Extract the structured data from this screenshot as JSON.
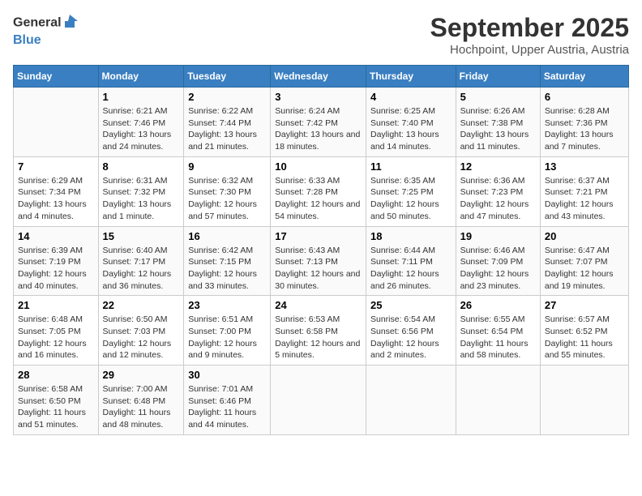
{
  "logo": {
    "text_general": "General",
    "text_blue": "Blue"
  },
  "title": "September 2025",
  "location": "Hochpoint, Upper Austria, Austria",
  "weekdays": [
    "Sunday",
    "Monday",
    "Tuesday",
    "Wednesday",
    "Thursday",
    "Friday",
    "Saturday"
  ],
  "weeks": [
    [
      {
        "day": "",
        "sunrise": "",
        "sunset": "",
        "daylight": ""
      },
      {
        "day": "1",
        "sunrise": "Sunrise: 6:21 AM",
        "sunset": "Sunset: 7:46 PM",
        "daylight": "Daylight: 13 hours and 24 minutes."
      },
      {
        "day": "2",
        "sunrise": "Sunrise: 6:22 AM",
        "sunset": "Sunset: 7:44 PM",
        "daylight": "Daylight: 13 hours and 21 minutes."
      },
      {
        "day": "3",
        "sunrise": "Sunrise: 6:24 AM",
        "sunset": "Sunset: 7:42 PM",
        "daylight": "Daylight: 13 hours and 18 minutes."
      },
      {
        "day": "4",
        "sunrise": "Sunrise: 6:25 AM",
        "sunset": "Sunset: 7:40 PM",
        "daylight": "Daylight: 13 hours and 14 minutes."
      },
      {
        "day": "5",
        "sunrise": "Sunrise: 6:26 AM",
        "sunset": "Sunset: 7:38 PM",
        "daylight": "Daylight: 13 hours and 11 minutes."
      },
      {
        "day": "6",
        "sunrise": "Sunrise: 6:28 AM",
        "sunset": "Sunset: 7:36 PM",
        "daylight": "Daylight: 13 hours and 7 minutes."
      }
    ],
    [
      {
        "day": "7",
        "sunrise": "Sunrise: 6:29 AM",
        "sunset": "Sunset: 7:34 PM",
        "daylight": "Daylight: 13 hours and 4 minutes."
      },
      {
        "day": "8",
        "sunrise": "Sunrise: 6:31 AM",
        "sunset": "Sunset: 7:32 PM",
        "daylight": "Daylight: 13 hours and 1 minute."
      },
      {
        "day": "9",
        "sunrise": "Sunrise: 6:32 AM",
        "sunset": "Sunset: 7:30 PM",
        "daylight": "Daylight: 12 hours and 57 minutes."
      },
      {
        "day": "10",
        "sunrise": "Sunrise: 6:33 AM",
        "sunset": "Sunset: 7:28 PM",
        "daylight": "Daylight: 12 hours and 54 minutes."
      },
      {
        "day": "11",
        "sunrise": "Sunrise: 6:35 AM",
        "sunset": "Sunset: 7:25 PM",
        "daylight": "Daylight: 12 hours and 50 minutes."
      },
      {
        "day": "12",
        "sunrise": "Sunrise: 6:36 AM",
        "sunset": "Sunset: 7:23 PM",
        "daylight": "Daylight: 12 hours and 47 minutes."
      },
      {
        "day": "13",
        "sunrise": "Sunrise: 6:37 AM",
        "sunset": "Sunset: 7:21 PM",
        "daylight": "Daylight: 12 hours and 43 minutes."
      }
    ],
    [
      {
        "day": "14",
        "sunrise": "Sunrise: 6:39 AM",
        "sunset": "Sunset: 7:19 PM",
        "daylight": "Daylight: 12 hours and 40 minutes."
      },
      {
        "day": "15",
        "sunrise": "Sunrise: 6:40 AM",
        "sunset": "Sunset: 7:17 PM",
        "daylight": "Daylight: 12 hours and 36 minutes."
      },
      {
        "day": "16",
        "sunrise": "Sunrise: 6:42 AM",
        "sunset": "Sunset: 7:15 PM",
        "daylight": "Daylight: 12 hours and 33 minutes."
      },
      {
        "day": "17",
        "sunrise": "Sunrise: 6:43 AM",
        "sunset": "Sunset: 7:13 PM",
        "daylight": "Daylight: 12 hours and 30 minutes."
      },
      {
        "day": "18",
        "sunrise": "Sunrise: 6:44 AM",
        "sunset": "Sunset: 7:11 PM",
        "daylight": "Daylight: 12 hours and 26 minutes."
      },
      {
        "day": "19",
        "sunrise": "Sunrise: 6:46 AM",
        "sunset": "Sunset: 7:09 PM",
        "daylight": "Daylight: 12 hours and 23 minutes."
      },
      {
        "day": "20",
        "sunrise": "Sunrise: 6:47 AM",
        "sunset": "Sunset: 7:07 PM",
        "daylight": "Daylight: 12 hours and 19 minutes."
      }
    ],
    [
      {
        "day": "21",
        "sunrise": "Sunrise: 6:48 AM",
        "sunset": "Sunset: 7:05 PM",
        "daylight": "Daylight: 12 hours and 16 minutes."
      },
      {
        "day": "22",
        "sunrise": "Sunrise: 6:50 AM",
        "sunset": "Sunset: 7:03 PM",
        "daylight": "Daylight: 12 hours and 12 minutes."
      },
      {
        "day": "23",
        "sunrise": "Sunrise: 6:51 AM",
        "sunset": "Sunset: 7:00 PM",
        "daylight": "Daylight: 12 hours and 9 minutes."
      },
      {
        "day": "24",
        "sunrise": "Sunrise: 6:53 AM",
        "sunset": "Sunset: 6:58 PM",
        "daylight": "Daylight: 12 hours and 5 minutes."
      },
      {
        "day": "25",
        "sunrise": "Sunrise: 6:54 AM",
        "sunset": "Sunset: 6:56 PM",
        "daylight": "Daylight: 12 hours and 2 minutes."
      },
      {
        "day": "26",
        "sunrise": "Sunrise: 6:55 AM",
        "sunset": "Sunset: 6:54 PM",
        "daylight": "Daylight: 11 hours and 58 minutes."
      },
      {
        "day": "27",
        "sunrise": "Sunrise: 6:57 AM",
        "sunset": "Sunset: 6:52 PM",
        "daylight": "Daylight: 11 hours and 55 minutes."
      }
    ],
    [
      {
        "day": "28",
        "sunrise": "Sunrise: 6:58 AM",
        "sunset": "Sunset: 6:50 PM",
        "daylight": "Daylight: 11 hours and 51 minutes."
      },
      {
        "day": "29",
        "sunrise": "Sunrise: 7:00 AM",
        "sunset": "Sunset: 6:48 PM",
        "daylight": "Daylight: 11 hours and 48 minutes."
      },
      {
        "day": "30",
        "sunrise": "Sunrise: 7:01 AM",
        "sunset": "Sunset: 6:46 PM",
        "daylight": "Daylight: 11 hours and 44 minutes."
      },
      {
        "day": "",
        "sunrise": "",
        "sunset": "",
        "daylight": ""
      },
      {
        "day": "",
        "sunrise": "",
        "sunset": "",
        "daylight": ""
      },
      {
        "day": "",
        "sunrise": "",
        "sunset": "",
        "daylight": ""
      },
      {
        "day": "",
        "sunrise": "",
        "sunset": "",
        "daylight": ""
      }
    ]
  ]
}
